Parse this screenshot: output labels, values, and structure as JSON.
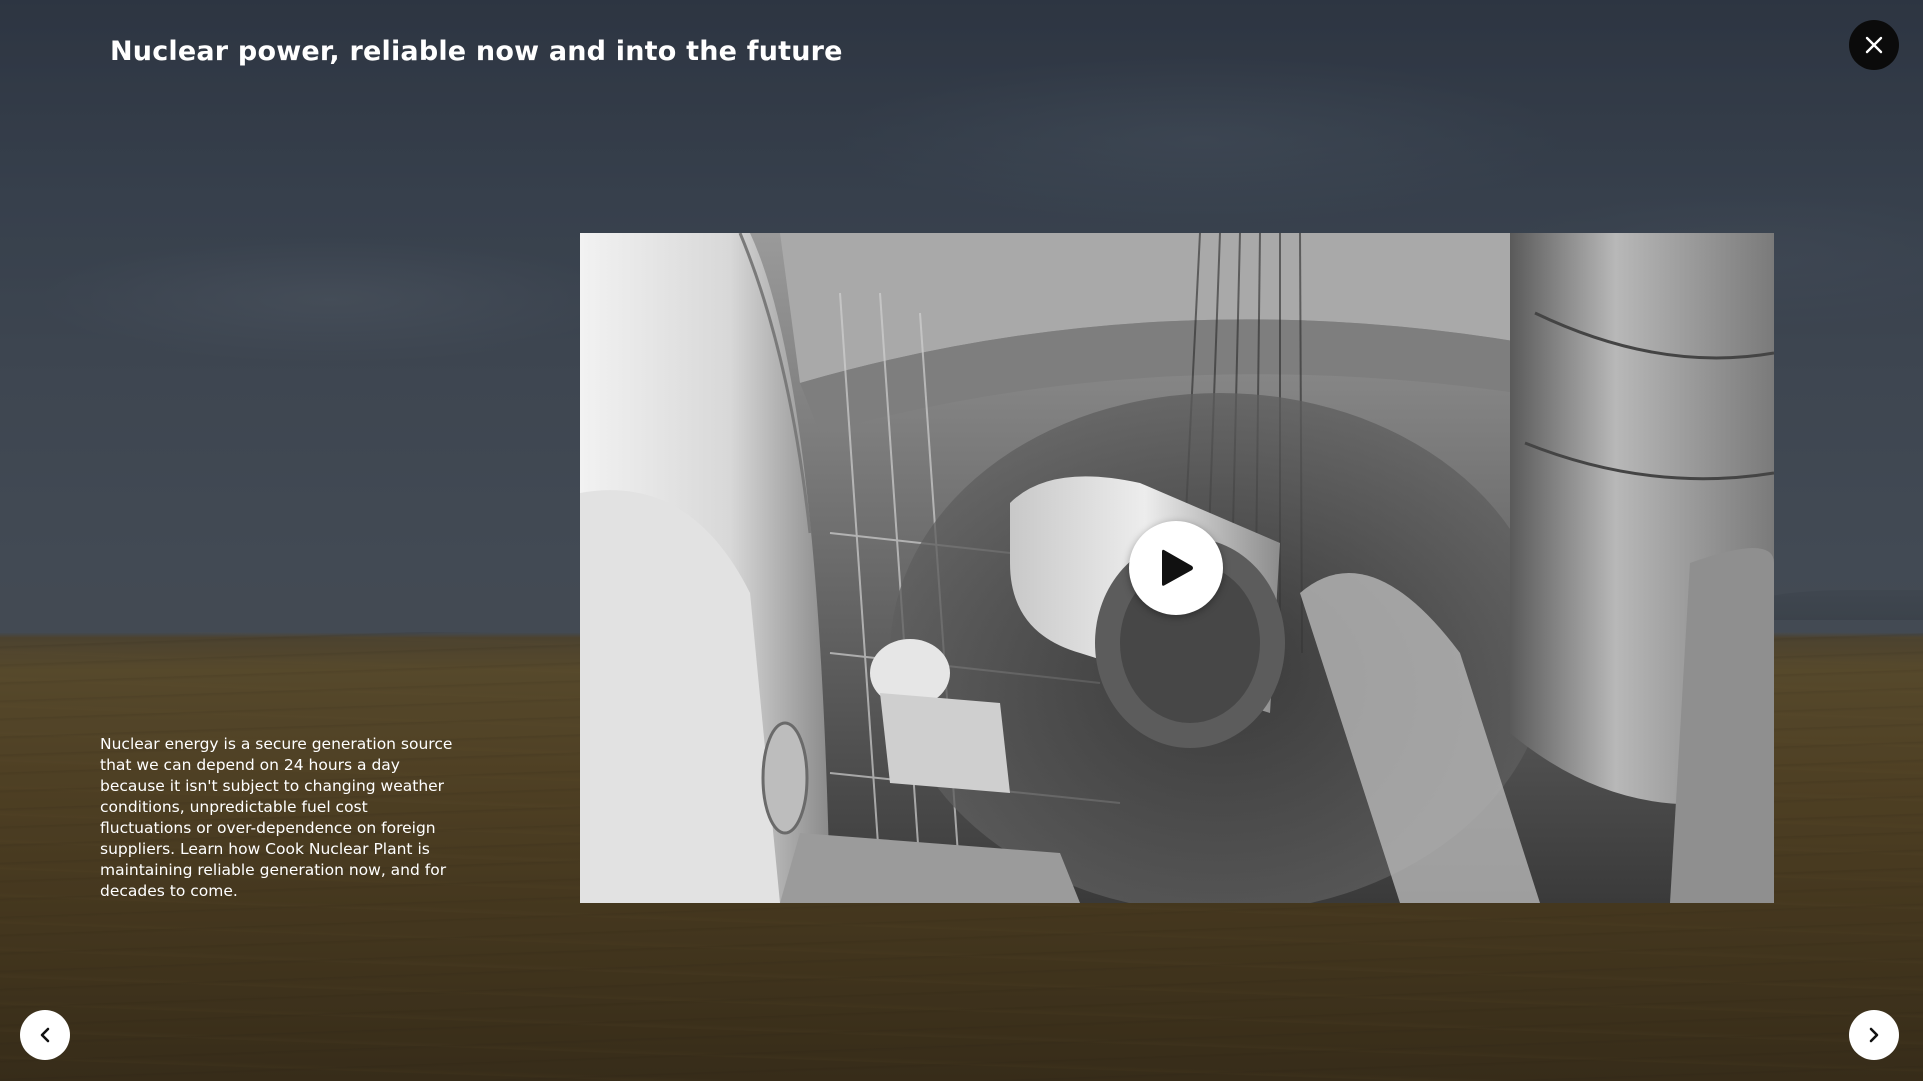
{
  "modal": {
    "title": "Nuclear power, reliable now and into the future",
    "description": "Nuclear energy is a secure generation source that we can depend on 24 hours a day because it isn't subject to changing weather conditions, unpredictable fuel cost fluctuations or over-dependence on foreign suppliers. Learn how Cook Nuclear Plant is maintaining reliable generation now, and for decades to come."
  },
  "controls": {
    "close_icon": "close-icon",
    "play_icon": "play-icon",
    "prev_icon": "chevron-left-icon",
    "next_icon": "chevron-right-icon"
  },
  "colors": {
    "close_button": "#0b0b0b",
    "nav_button": "#ffffff",
    "play_button": "#ffffff",
    "text": "#ffffff"
  }
}
